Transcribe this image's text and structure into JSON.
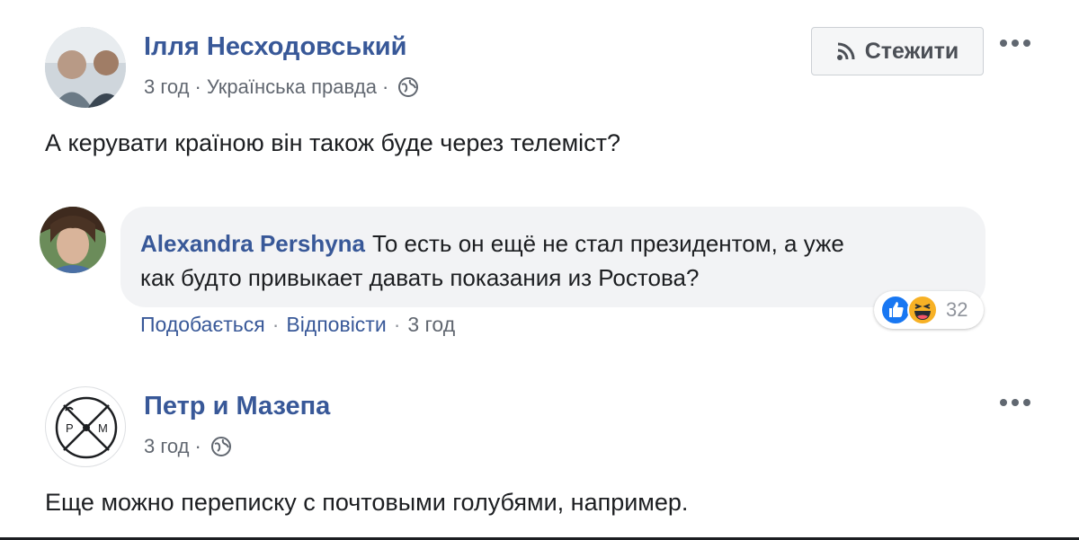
{
  "post1": {
    "author": "Ілля Несходовський",
    "time": "3 год",
    "source": "Українська правда",
    "follow_label": "Стежити",
    "text": "А керувати країною він також буде через телеміст?"
  },
  "comment": {
    "author": "Alexandra Pershyna",
    "text_line1": "То есть он ещё не стал президентом, а уже",
    "text_line2": "как будто привыкает давать показания из Ростова?",
    "like_label": "Подобається",
    "reply_label": "Відповісти",
    "time": "3 год",
    "reaction_count": "32",
    "reaction_icons": [
      "like-icon",
      "haha-icon"
    ]
  },
  "post2": {
    "author": "Петр и Мазепа",
    "time": "3 год",
    "logo_letters": [
      "P",
      "M"
    ],
    "text": "Еще можно переписку с почтовыми голубями, например."
  },
  "colors": {
    "link": "#385898",
    "meta": "#616770",
    "bubble": "#f2f3f5",
    "like_blue": "#1877f2",
    "haha_yellow": "#f7b125"
  }
}
